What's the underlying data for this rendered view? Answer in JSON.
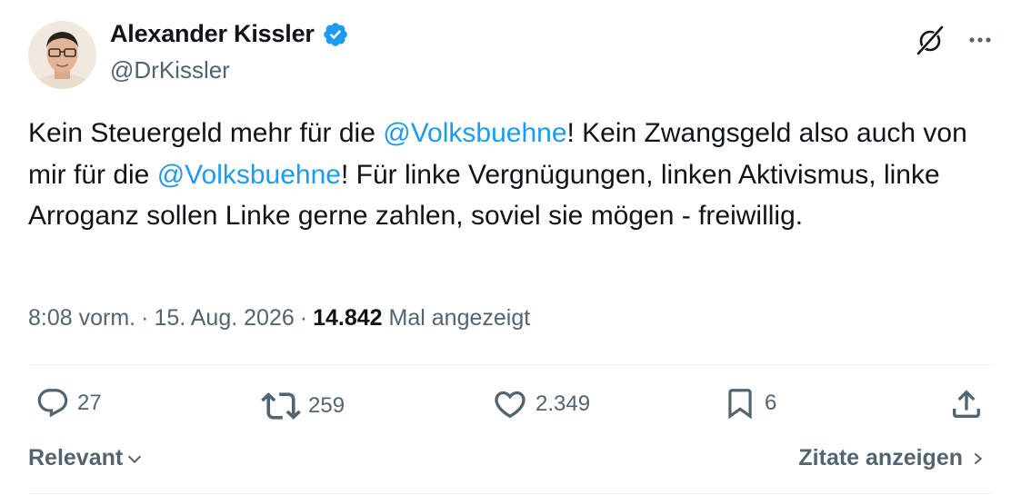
{
  "author": {
    "display_name": "Alexander Kissler",
    "handle": "@DrKissler",
    "verified": true
  },
  "tweet": {
    "segments": [
      {
        "text": "Kein Steuergeld mehr für die ",
        "type": "text"
      },
      {
        "text": "@Volksbuehne",
        "type": "mention"
      },
      {
        "text": "! Kein Zwangsgeld also auch von mir für die ",
        "type": "text"
      },
      {
        "text": "@Volksbuehne",
        "type": "mention"
      },
      {
        "text": "! Für linke Vergnügungen, linken Aktivismus, linke Arroganz sollen Linke gerne zahlen, soviel sie mögen - freiwillig.",
        "type": "text"
      }
    ]
  },
  "meta": {
    "time": "8:08 vorm.",
    "separator": "·",
    "date": "15. Aug. 2026",
    "views_count": "14.842",
    "views_label": "Mal angezeigt"
  },
  "actions": {
    "replies": "27",
    "reposts": "259",
    "likes": "2.349",
    "bookmarks": "6"
  },
  "footer": {
    "sort_label": "Relevant",
    "quotes_label": "Zitate anzeigen"
  },
  "colors": {
    "mention": "#1d9bf0",
    "verified": "#1d9bf0",
    "muted": "#536471",
    "text": "#0f1419"
  },
  "icons": [
    "verified-badge-icon",
    "grok-icon",
    "more-icon",
    "reply-icon",
    "repost-icon",
    "like-icon",
    "bookmark-icon",
    "share-icon",
    "chevron-down-icon",
    "chevron-right-icon"
  ]
}
